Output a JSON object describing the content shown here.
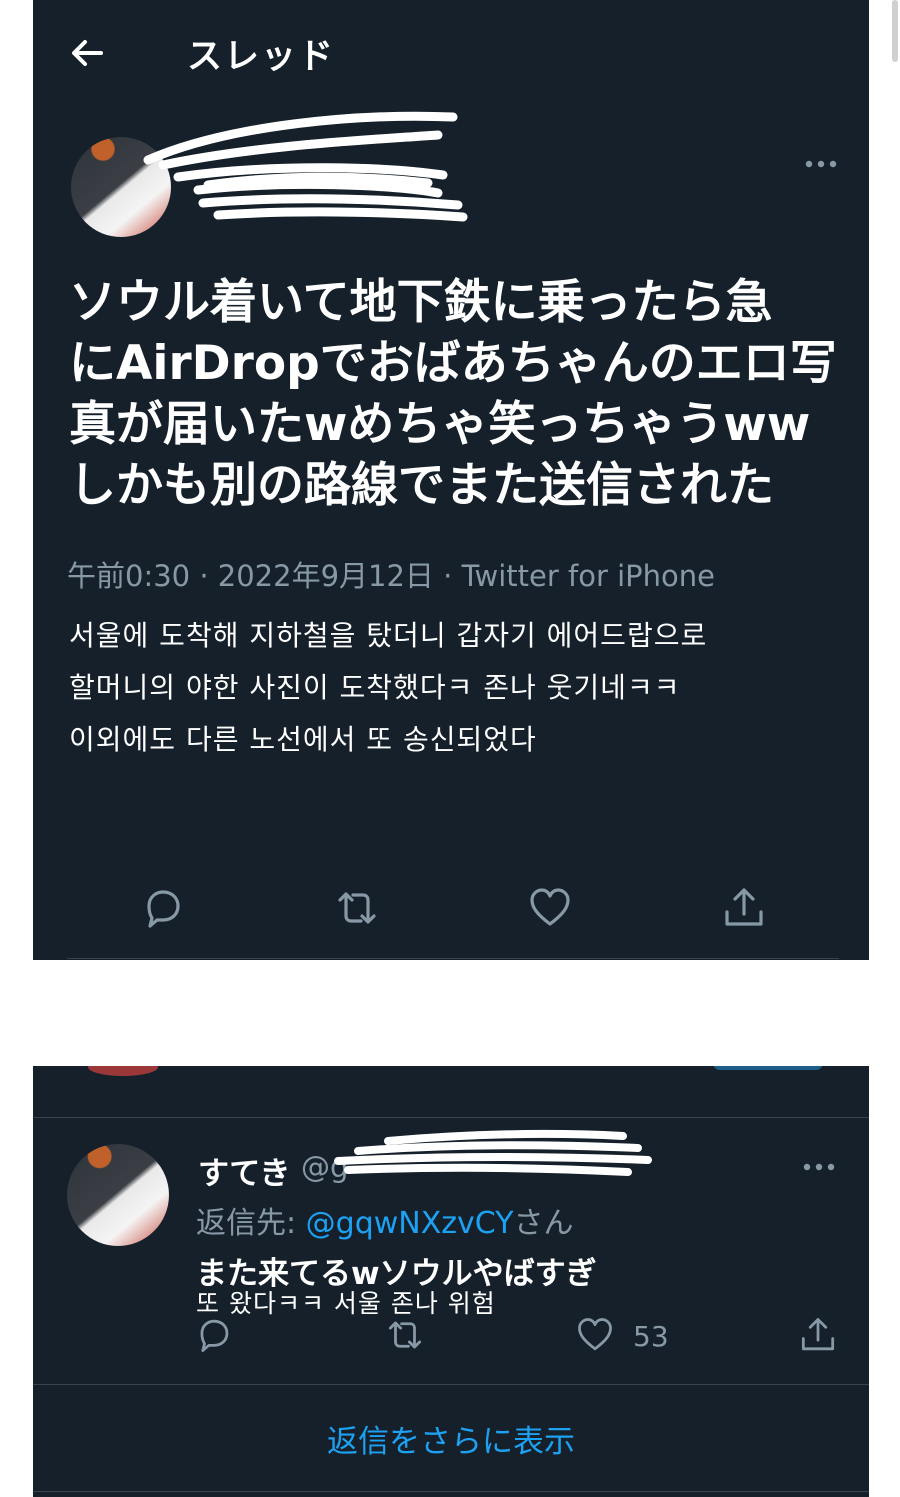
{
  "header": {
    "title": "スレッド"
  },
  "tweet": {
    "text_lines": [
      "ソウル着いて地下鉄に乗ったら急",
      "にAirDropでおばあちゃんのエロ写",
      "真が届いたwめちゃ笑っちゃうww",
      "しかも別の路線でまた送信された"
    ],
    "meta": "午前0:30 · 2022年9月12日 · Twitter for iPhone",
    "translation_lines": [
      "서울에 도착해 지하철을 탔더니 갑자기 에어드랍으로",
      "할머니의 야한 사진이 도착했다ㅋ 존나 웃기네ㅋㅋ",
      "이외에도 다른 노선에서 또 송신되었다"
    ]
  },
  "reply": {
    "name": "すてき",
    "handle_prefix": "@g",
    "reply_to_prefix": "返信先: ",
    "reply_to_mention": "@gqwNXzvCY",
    "reply_to_suffix": "さん",
    "text": "また来てるwソウルやばすぎ",
    "translation": "또 왔다ㅋㅋ 서울 존나 위험",
    "like_count": "53"
  },
  "show_more": "返信をさらに表示",
  "icons": {
    "back": "arrow-left-icon",
    "more": "more-horizontal-icon",
    "reply": "reply-icon",
    "retweet": "retweet-icon",
    "like": "heart-icon",
    "share": "share-icon"
  },
  "colors": {
    "background": "#15202b",
    "text": "#ffffff",
    "secondary_text": "#8899a6",
    "accent": "#1da1f2",
    "divider": "#38444d"
  }
}
